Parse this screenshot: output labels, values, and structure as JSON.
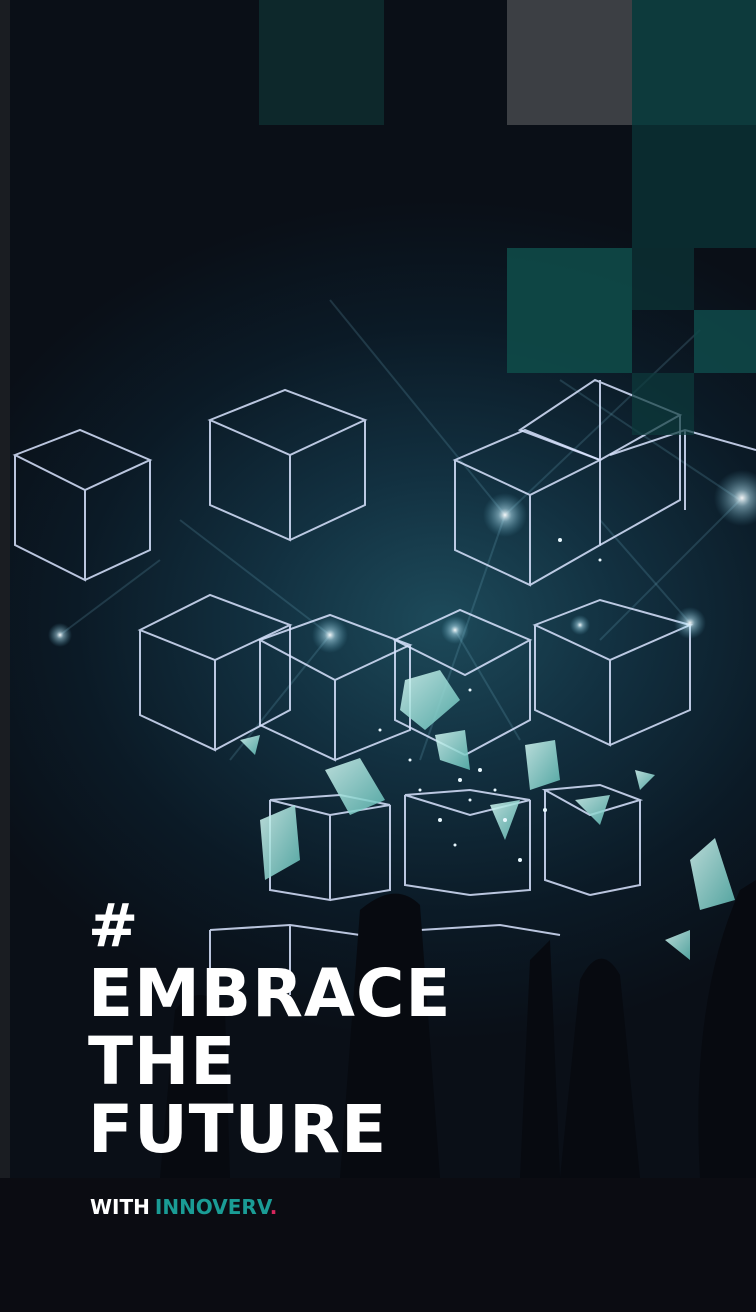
{
  "headline": {
    "hash": "#",
    "line1": "EMBRACE",
    "line2": "THE",
    "line3": "FUTURE"
  },
  "tagline": {
    "prefix": "WITH",
    "brand": "INNOVERV",
    "dot": "."
  },
  "colors": {
    "accent_teal": "#1a9c95",
    "accent_pink": "#d7265c",
    "tile_teal": "#0e4a48",
    "tile_gray": "#3c3f44",
    "text": "#ffffff"
  }
}
